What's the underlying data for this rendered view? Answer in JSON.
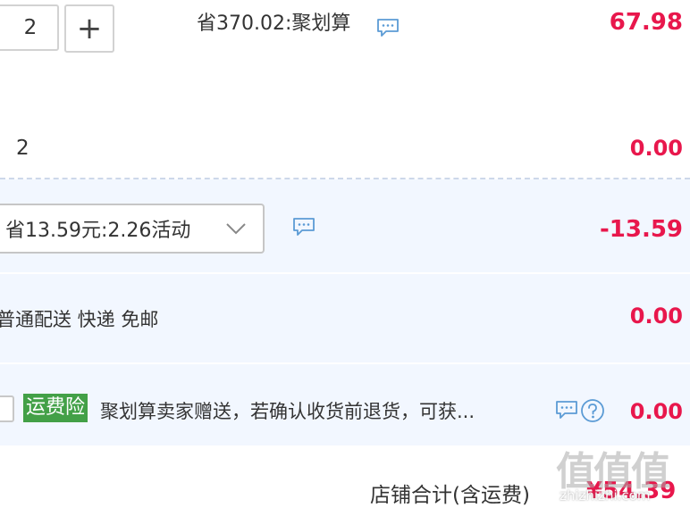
{
  "item": {
    "quantity": "2",
    "plus_symbol": "+",
    "savings_text": "省370.02:聚划算",
    "price": "67.98"
  },
  "gift_row": {
    "quantity": "2",
    "price": "0.00"
  },
  "promotion": {
    "selected": "省13.59元:2.26活动",
    "amount": "-13.59"
  },
  "delivery": {
    "text": "普通配送 快递 免邮",
    "price": "0.00"
  },
  "insurance": {
    "badge": "运费险",
    "text": "聚划算卖家赠送，若确认收货前退货，可获...",
    "price": "0.00"
  },
  "summary": {
    "label": "店铺合计(含运费)",
    "total": "¥54.39"
  },
  "watermark": {
    "main": "值值值",
    "site": "zhizhizhi.com"
  },
  "colors": {
    "price_red": "#e8174c",
    "badge_green": "#43a047",
    "icon_blue": "#5b9bd5",
    "section_bg": "#f2f7ff"
  },
  "icons": [
    "comment-icon",
    "chevron-down-icon",
    "help-circle-icon",
    "plus-icon"
  ]
}
